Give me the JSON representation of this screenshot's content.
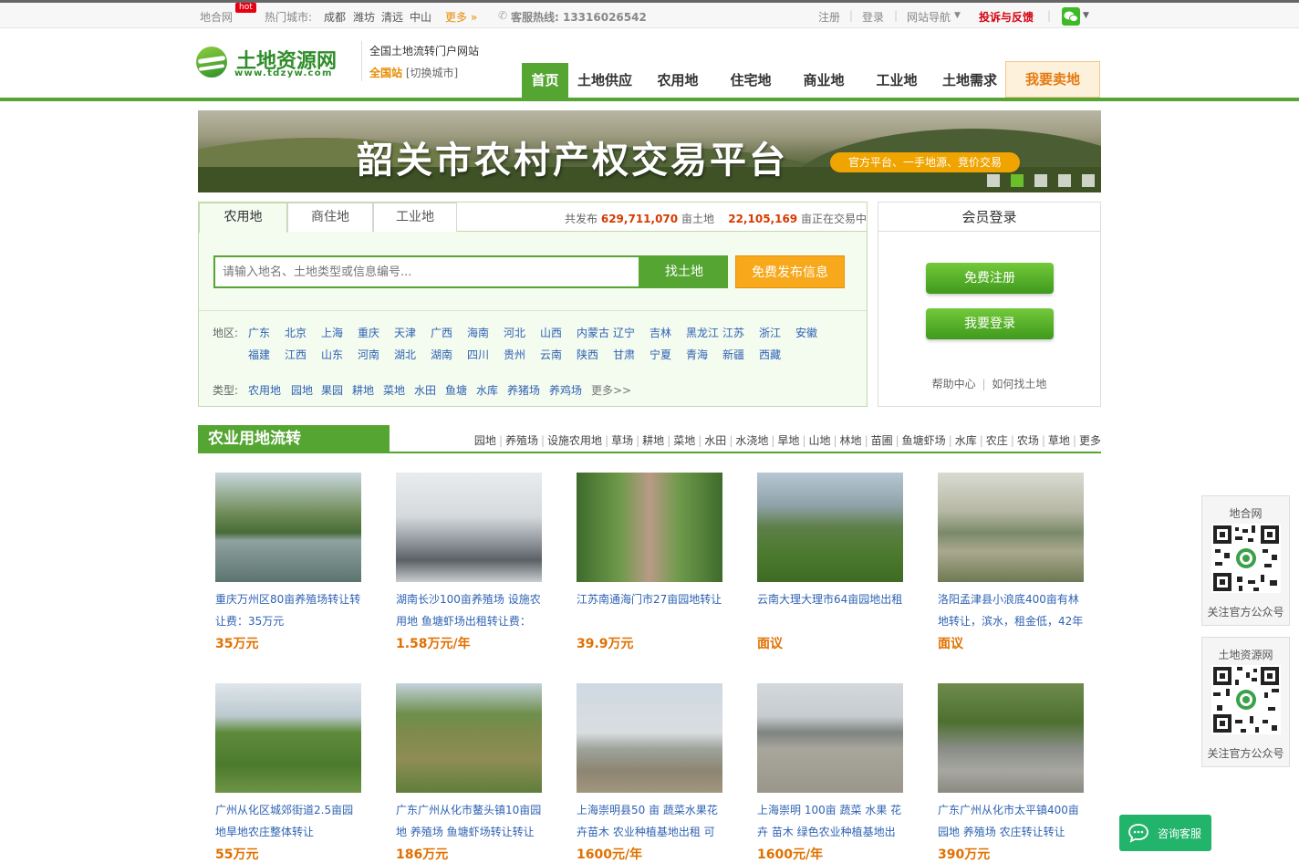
{
  "topbar": {
    "site_name": "地合网",
    "hot_badge": "hot",
    "hot_cities_label": "热门城市:",
    "cities": [
      "成都",
      "潍坊",
      "清远",
      "中山"
    ],
    "more": "更多 »",
    "hotline": "客服热线: 13316026542",
    "register": "注册",
    "login": "登录",
    "site_nav": "网站导航",
    "complaint": "投诉与反馈"
  },
  "header": {
    "logo_cn": "土地资源网",
    "logo_en": "www.tdzyw.com",
    "slogan": "全国土地流转门户网站",
    "city_current": "全国站",
    "city_switch": "[切换城市]"
  },
  "nav": {
    "items": [
      "首页",
      "土地供应",
      "农用地",
      "住宅地",
      "商业地",
      "工业地",
      "土地需求"
    ],
    "sell": "我要卖地"
  },
  "banner": {
    "title": "韶关市农村产权交易平台",
    "subtitle": "官方平台、一手地源、竞价交易",
    "active_slide": 2,
    "slide_count": 5
  },
  "search": {
    "tabs": [
      "农用地",
      "商住地",
      "工业地"
    ],
    "active_tab": "农用地",
    "stats_prefix": "共发布",
    "stats_total": "629,711,070",
    "stats_mid": "亩土地",
    "stats_trading": "22,105,169",
    "stats_suffix": "亩正在交易中",
    "placeholder": "请输入地名、土地类型或信息编号...",
    "search_button": "找土地",
    "publish_button": "免费发布信息",
    "region_label": "地区:",
    "regions_row1": [
      "广东",
      "北京",
      "上海",
      "重庆",
      "天津",
      "广西",
      "海南",
      "河北",
      "山西",
      "内蒙古",
      "辽宁",
      "吉林",
      "黑龙江",
      "江苏",
      "浙江",
      "安徽"
    ],
    "regions_row2": [
      "福建",
      "江西",
      "山东",
      "河南",
      "湖北",
      "湖南",
      "四川",
      "贵州",
      "云南",
      "陕西",
      "甘肃",
      "宁夏",
      "青海",
      "新疆",
      "西藏"
    ],
    "type_label": "类型:",
    "types": [
      "农用地",
      "园地",
      "果园",
      "耕地",
      "菜地",
      "水田",
      "鱼塘",
      "水库",
      "养猪场",
      "养鸡场",
      "更多>>"
    ]
  },
  "login": {
    "title": "会员登录",
    "register_button": "免费注册",
    "login_button": "我要登录",
    "help": "帮助中心",
    "how_to": "如何找土地"
  },
  "section": {
    "title": "农业用地流转",
    "links": [
      "园地",
      "养殖场",
      "设施农用地",
      "草场",
      "耕地",
      "菜地",
      "水田",
      "水浇地",
      "旱地",
      "山地",
      "林地",
      "苗圃",
      "鱼塘虾场",
      "水库",
      "农庄",
      "农场",
      "草地",
      "更多"
    ]
  },
  "listings": [
    {
      "title": "重庆万州区80亩养殖场转让转让费：35万元",
      "price": "35万元"
    },
    {
      "title": "湖南长沙100亩养殖场 设施农用地 鱼塘虾场出租转让费：",
      "price": "1.58万元/年"
    },
    {
      "title": "江苏南通海门市27亩园地转让",
      "price": "39.9万元"
    },
    {
      "title": "云南大理大理市64亩园地出租",
      "price": "面议"
    },
    {
      "title": "洛阳孟津县小浪底400亩有林地转让，滨水，租金低，42年",
      "price": "面议"
    },
    {
      "title": "广州从化区城郊街道2.5亩园地旱地农庄整体转让",
      "price": "55万元"
    },
    {
      "title": "广东广州从化市鳌头镇10亩园地 养殖场 鱼塘虾场转让转让",
      "price": "186万元"
    },
    {
      "title": "上海崇明县50 亩 蔬菜水果花卉苗木 农业种植基地出租 可",
      "price": "1600元/年"
    },
    {
      "title": "上海崇明 100亩 蔬菜 水果 花卉 苗木 绿色农业种植基地出",
      "price": "1600元/年"
    },
    {
      "title": "广东广州从化市太平镇400亩园地 养殖场 农庄转让转让",
      "price": "390万元"
    }
  ],
  "sidebar": {
    "qr1_top": "地合网",
    "qr1_bottom": "关注官方公众号",
    "qr2_top": "土地资源网",
    "qr2_bottom": "关注官方公众号",
    "service": "咨询客服"
  },
  "colors": {
    "brand_green": "#55a532",
    "orange": "#f7a81b",
    "link_blue": "#2e62b3",
    "price_orange": "#e07000"
  }
}
